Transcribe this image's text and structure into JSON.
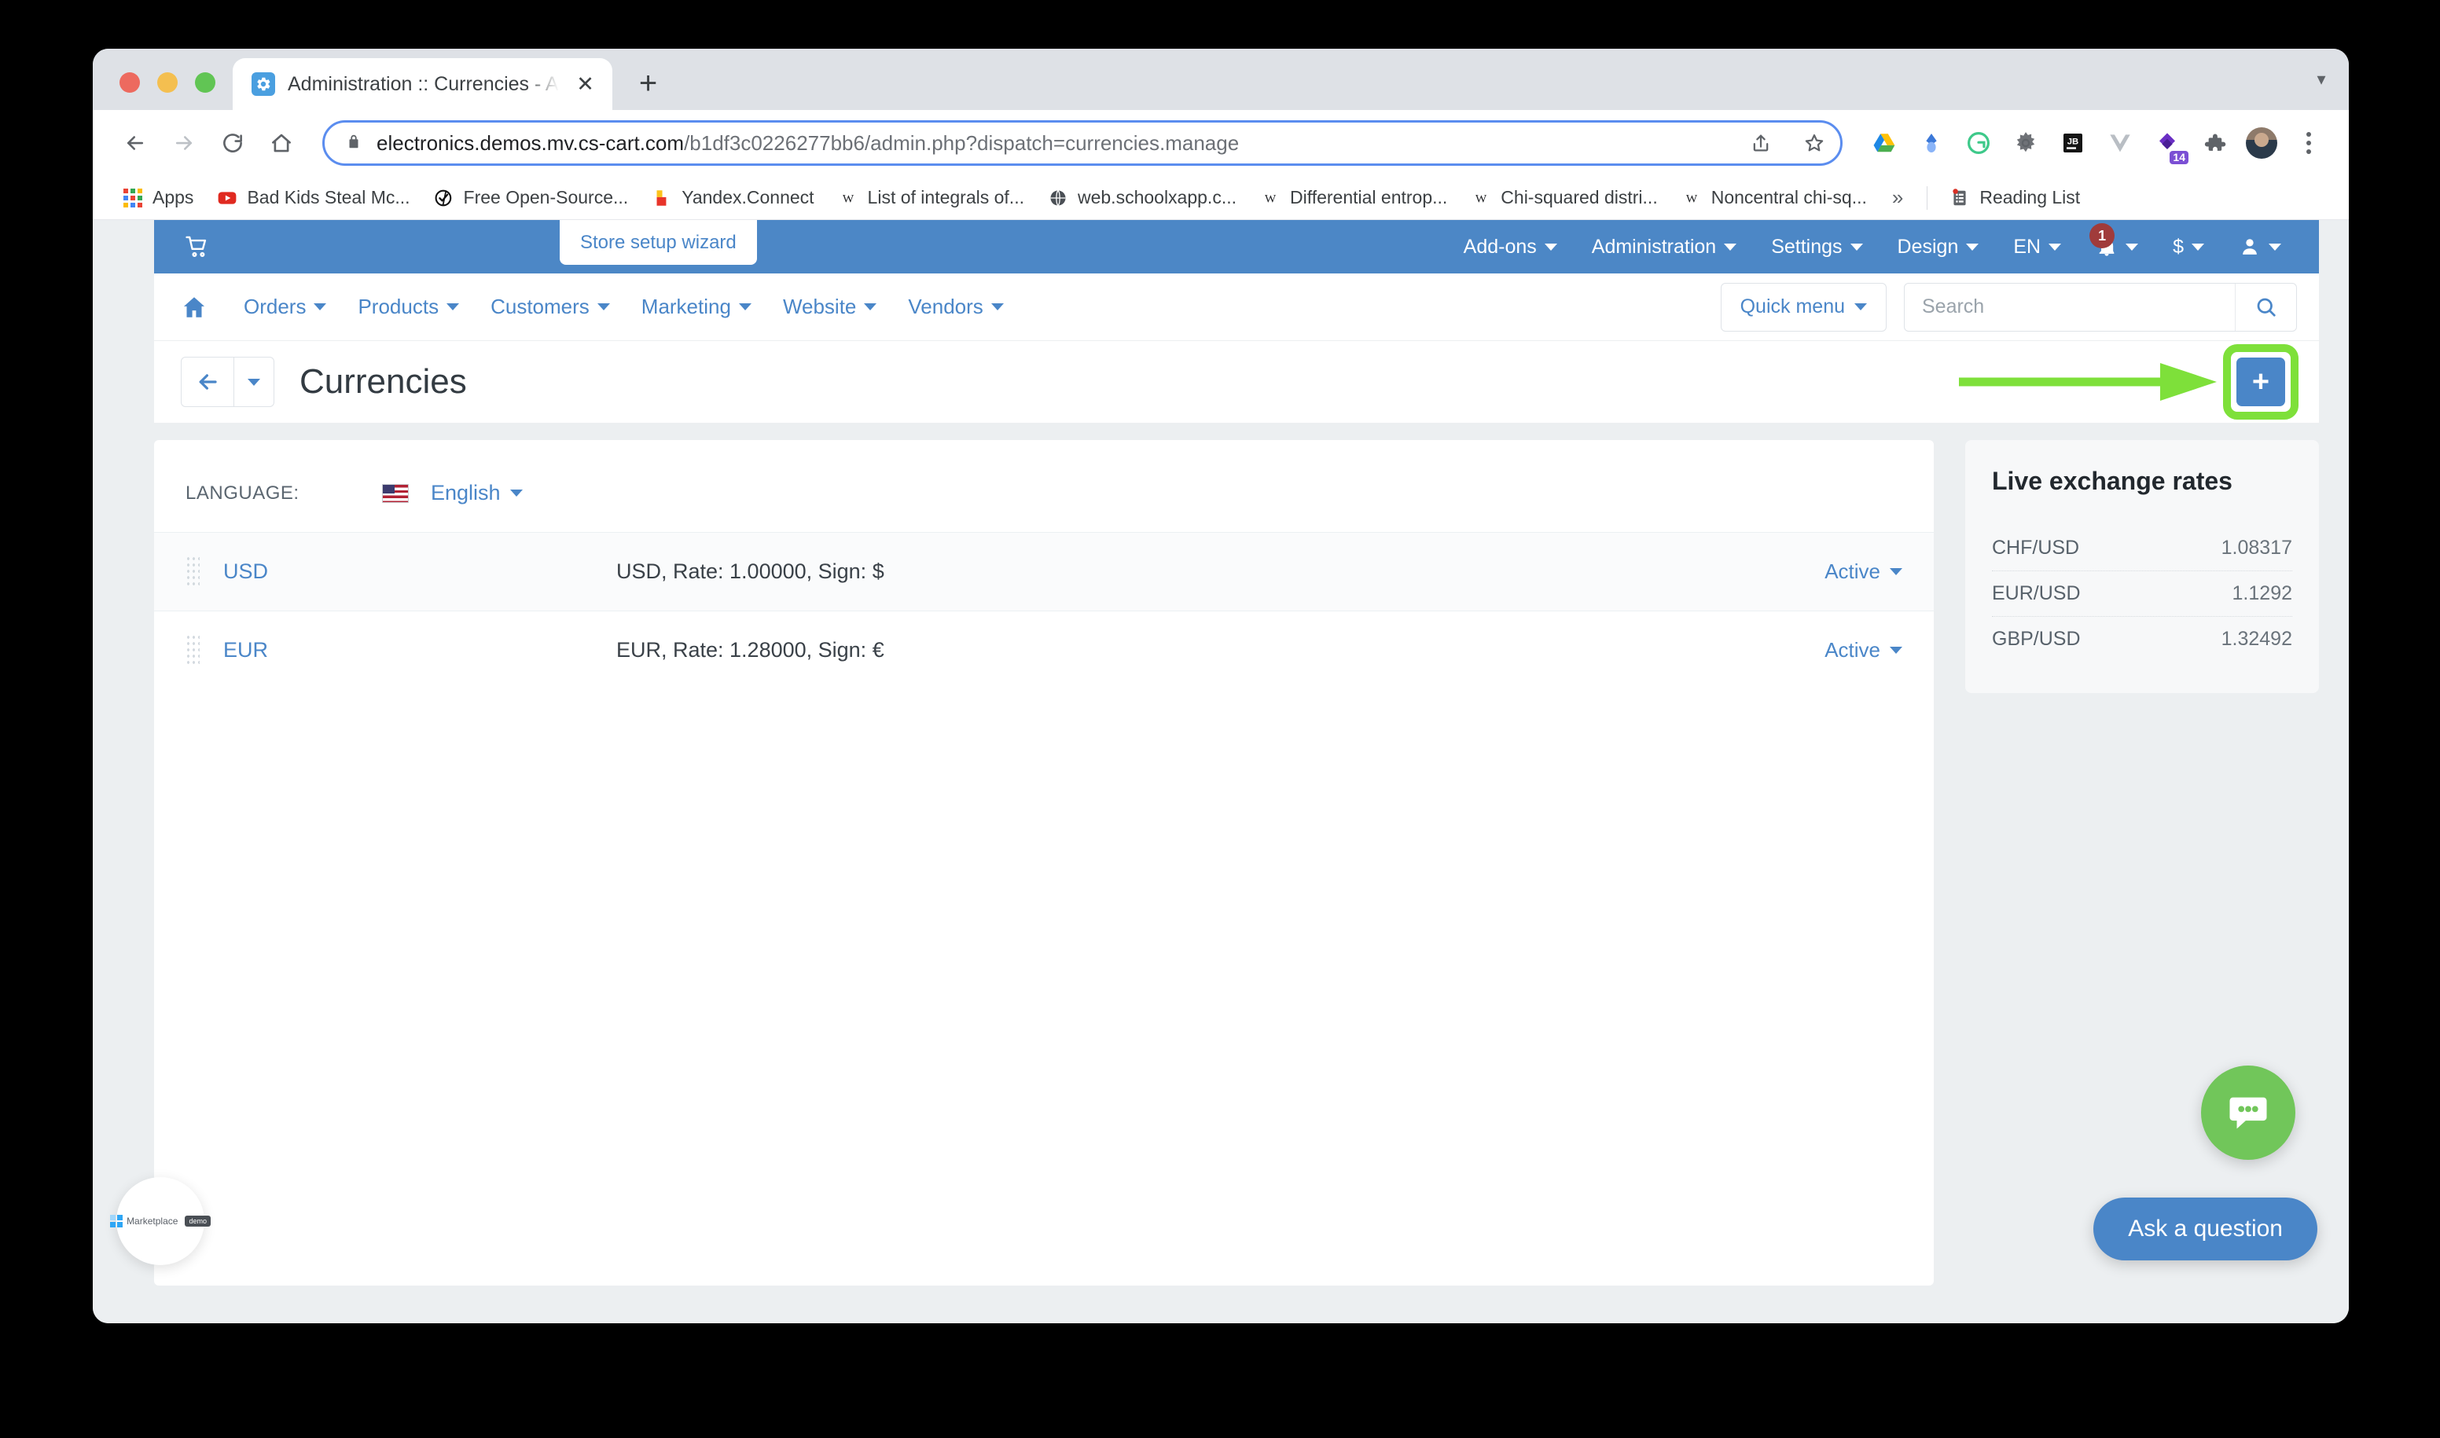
{
  "browser": {
    "tab": {
      "title": "Administration :: Currencies - A",
      "favicon": "gear-icon",
      "close": "✕"
    },
    "new_tab": "+",
    "window_caret": "▾",
    "omnibox": {
      "url_domain": "electronics.demos.mv.cs-cart.com",
      "url_path": "/b1df3c0226277bb6/admin.php?dispatch=currencies.manage",
      "lock": "lock-icon",
      "share": "share-icon",
      "bookmark": "star-icon"
    },
    "nav": {
      "back": "←",
      "forward": "→",
      "reload": "↻",
      "home": "⌂"
    },
    "extensions": [
      {
        "name": "google-drive-icon"
      },
      {
        "name": "blue-diamond-icon"
      },
      {
        "name": "grammarly-icon"
      },
      {
        "name": "gear-extension-icon"
      },
      {
        "name": "jetbrains-icon"
      },
      {
        "name": "vue-devtools-icon"
      },
      {
        "name": "purple-extension-icon",
        "badge": "14"
      },
      {
        "name": "puzzle-extensions-icon"
      }
    ],
    "profile": "avatar",
    "menu": "kebab-menu-icon",
    "bookmarks": [
      {
        "label": "Apps",
        "icon": "apps-grid-icon"
      },
      {
        "label": "Bad Kids Steal Mc...",
        "icon": "youtube-icon"
      },
      {
        "label": "Free Open-Source...",
        "icon": "check-circle-icon"
      },
      {
        "label": "Yandex.Connect",
        "icon": "yandex-icon"
      },
      {
        "label": "List of integrals of...",
        "icon": "wikipedia-icon"
      },
      {
        "label": "web.schoolxapp.c...",
        "icon": "globe-icon"
      },
      {
        "label": "Differential entrop...",
        "icon": "wikipedia-icon"
      },
      {
        "label": "Chi-squared distri...",
        "icon": "wikipedia-icon"
      },
      {
        "label": "Noncentral chi-sq...",
        "icon": "wikipedia-icon"
      }
    ],
    "bookmarks_overflow": "»",
    "reading_list": "Reading List"
  },
  "admin": {
    "cart_icon": "shopping-cart-icon",
    "wizard": "Store setup wizard",
    "top_menu": [
      {
        "label": "Add-ons"
      },
      {
        "label": "Administration"
      },
      {
        "label": "Settings"
      },
      {
        "label": "Design"
      },
      {
        "label": "EN"
      }
    ],
    "notifications_count": "1",
    "currency_switcher": "$",
    "nav": {
      "home_icon": "home-icon",
      "items": [
        {
          "label": "Orders"
        },
        {
          "label": "Products"
        },
        {
          "label": "Customers"
        },
        {
          "label": "Marketing"
        },
        {
          "label": "Website"
        },
        {
          "label": "Vendors"
        }
      ],
      "quick_menu": "Quick menu",
      "search_placeholder": "Search",
      "search_value": ""
    },
    "page": {
      "title": "Currencies",
      "back_icon": "arrow-left-icon",
      "back_caret": "▾",
      "add_button": "+"
    },
    "language": {
      "label": "LANGUAGE:",
      "value": "English",
      "flag": "us-flag-icon"
    },
    "currencies": [
      {
        "code": "USD",
        "description": "USD, Rate: 1.00000, Sign: $",
        "status": "Active"
      },
      {
        "code": "EUR",
        "description": "EUR, Rate: 1.28000, Sign: €",
        "status": "Active"
      }
    ],
    "live_rates": {
      "title": "Live exchange rates",
      "rows": [
        {
          "pair": "CHF/USD",
          "value": "1.08317"
        },
        {
          "pair": "EUR/USD",
          "value": "1.1292"
        },
        {
          "pair": "GBP/USD",
          "value": "1.32492"
        }
      ]
    },
    "widgets": {
      "marketplace_label": "Marketplace",
      "marketplace_tag": "demo",
      "chat_icon": "chat-bubble-icon",
      "ask_button": "Ask a question"
    },
    "colors": {
      "brand_blue": "#4a86c8",
      "highlight_green": "#7ee03a",
      "chat_green": "#71c65a",
      "badge_red": "#a03b3b"
    }
  }
}
